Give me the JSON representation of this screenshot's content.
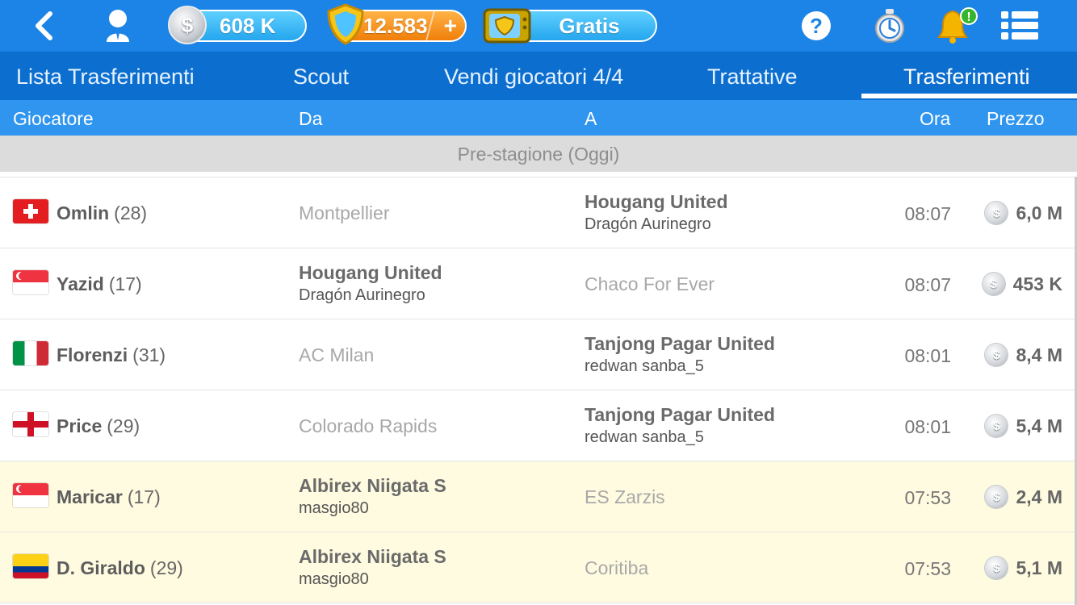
{
  "topbar": {
    "coins": "608 K",
    "credits": "12.583",
    "credits_plus": "+",
    "free_label": "Gratis",
    "coin_symbol": "$",
    "help_symbol": "?",
    "notification_badge": "!"
  },
  "tabs": [
    {
      "label": "Lista Trasferimenti",
      "active": false
    },
    {
      "label": "Scout",
      "active": false
    },
    {
      "label": "Vendi giocatori 4/4",
      "active": false
    },
    {
      "label": "Trattative",
      "active": false
    },
    {
      "label": "Trasferimenti",
      "active": true
    }
  ],
  "columns": {
    "player": "Giocatore",
    "from": "Da",
    "to": "A",
    "time": "Ora",
    "price": "Prezzo"
  },
  "section_title": "Pre-stagione (Oggi)",
  "transfers": [
    {
      "flag": "switzerland",
      "player": "Omlin",
      "age": "(28)",
      "from_club": "Montpellier",
      "from_manager": "",
      "to_club": "Hougang United",
      "to_manager": "Dragón Aurinegro",
      "time": "08:07",
      "price": "6,0 M",
      "highlight": false
    },
    {
      "flag": "singapore",
      "player": "Yazid",
      "age": "(17)",
      "from_club": "Hougang United",
      "from_manager": "Dragón Aurinegro",
      "to_club": "Chaco For Ever",
      "to_manager": "",
      "time": "08:07",
      "price": "453 K",
      "highlight": false
    },
    {
      "flag": "italy",
      "player": "Florenzi",
      "age": "(31)",
      "from_club": "AC Milan",
      "from_manager": "",
      "to_club": "Tanjong Pagar United",
      "to_manager": "redwan sanba_5",
      "time": "08:01",
      "price": "8,4 M",
      "highlight": false
    },
    {
      "flag": "england",
      "player": "Price",
      "age": "(29)",
      "from_club": "Colorado Rapids",
      "from_manager": "",
      "to_club": "Tanjong Pagar United",
      "to_manager": "redwan sanba_5",
      "time": "08:01",
      "price": "5,4 M",
      "highlight": false
    },
    {
      "flag": "singapore",
      "player": "Maricar",
      "age": "(17)",
      "from_club": "Albirex Niigata S",
      "from_manager": "masgio80",
      "to_club": "ES Zarzis",
      "to_manager": "",
      "time": "07:53",
      "price": "2,4 M",
      "highlight": true
    },
    {
      "flag": "colombia",
      "player": "D. Giraldo",
      "age": "(29)",
      "from_club": "Albirex Niigata S",
      "from_manager": "masgio80",
      "to_club": "Coritiba",
      "to_manager": "",
      "time": "07:53",
      "price": "5,1 M",
      "highlight": true
    }
  ],
  "colors": {
    "topbar": "#1b84e6",
    "tabs": "#0c6fd0",
    "column_header": "#2f95ee",
    "highlight_row": "#fffbe0"
  }
}
